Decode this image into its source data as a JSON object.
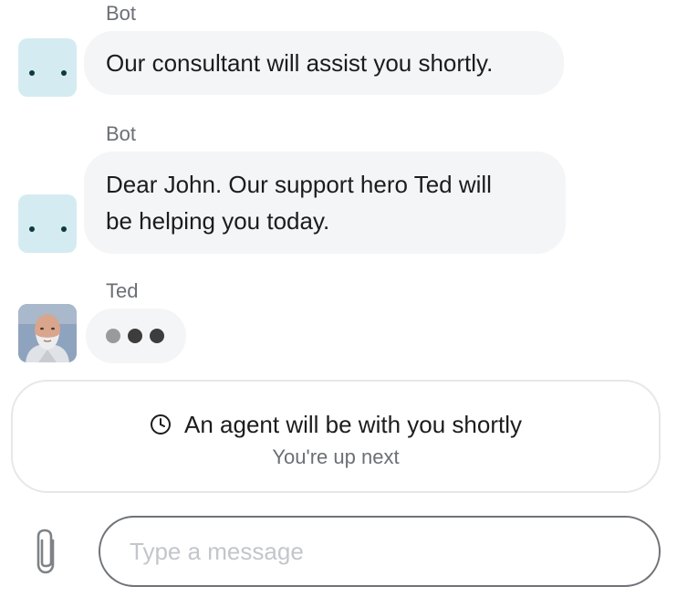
{
  "messages": [
    {
      "sender": "Bot",
      "text": "Our consultant will assist you shortly.",
      "avatar": "bot-face-icon"
    },
    {
      "sender": "Bot",
      "text_lines": [
        "Dear John. Our support hero Ted will",
        "be helping you today."
      ],
      "avatar": "bot-face-icon"
    },
    {
      "sender": "Ted",
      "status": "typing",
      "avatar": "agent-photo"
    }
  ],
  "queue": {
    "icon": "clock-icon",
    "title": "An agent will be with you shortly",
    "subtitle": "You're up next"
  },
  "composer": {
    "attach_icon": "paperclip-icon",
    "placeholder": "Type a message",
    "value": ""
  },
  "colors": {
    "bot_avatar_bg": "#d4ecf1",
    "bubble_bg": "#f4f5f7",
    "secondary_text": "#6b6f76"
  }
}
